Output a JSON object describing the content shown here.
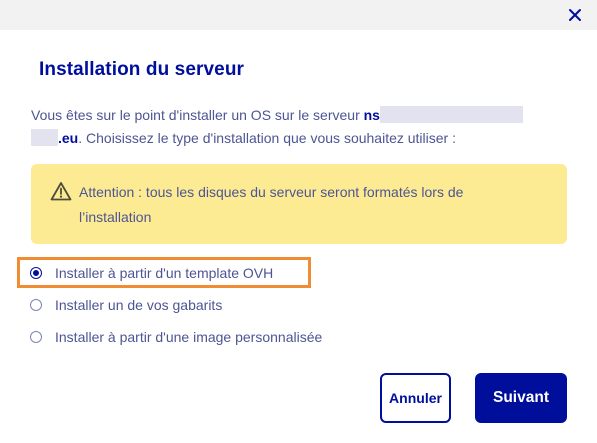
{
  "dialog": {
    "title": "Installation du serveur",
    "close_icon": "close-icon",
    "description": {
      "prefix": "Vous êtes sur le point d'installer un OS sur le serveur ",
      "server_name_start": "ns",
      "server_name_end": ".eu",
      "suffix": ". Choisissez le type d'installation que vous souhaitez utiliser :"
    },
    "alert": {
      "icon": "warning-icon",
      "text": "Attention : tous les disques du serveur seront formatés lors de l’installation"
    },
    "options": [
      {
        "label": "Installer à partir d'un template OVH",
        "checked": true
      },
      {
        "label": "Installer un de vos gabarits",
        "checked": false
      },
      {
        "label": "Installer à partir d'une image personnalisée",
        "checked": false
      }
    ],
    "buttons": {
      "cancel": "Annuler",
      "next": "Suivant"
    }
  },
  "colors": {
    "primary": "#000e9c",
    "text": "#4d5592",
    "alert_bg": "#fdeb94",
    "highlight": "#f08c33",
    "topbar": "#f2f2f2"
  }
}
